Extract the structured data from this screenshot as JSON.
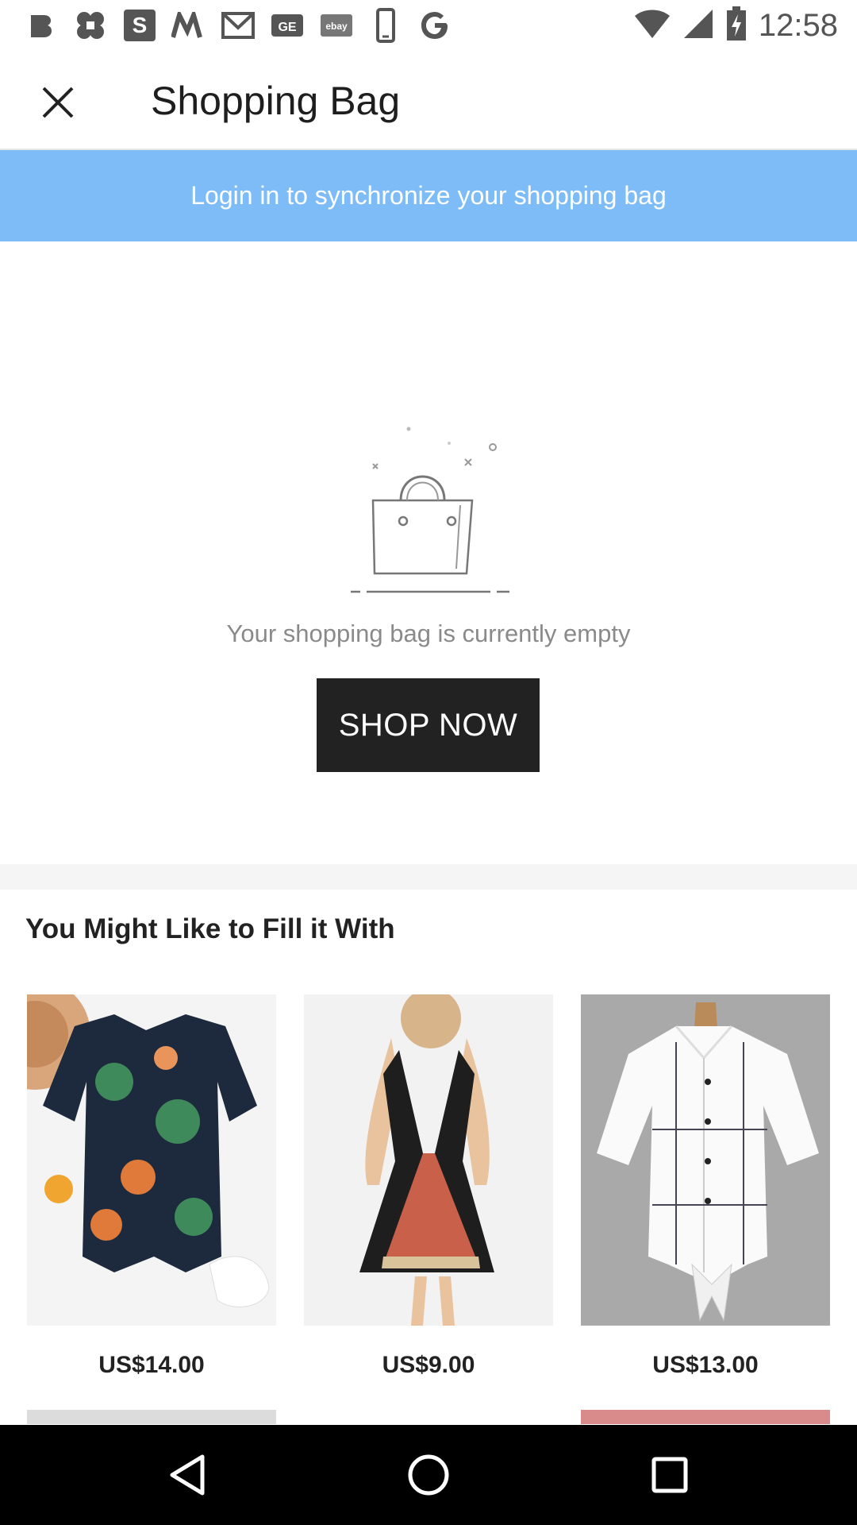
{
  "status_bar": {
    "time": "12:58",
    "left_icons": [
      "b-app-icon",
      "cluster-app-icon",
      "s-app-icon",
      "m-app-icon",
      "gmail-icon",
      "ge-app-icon",
      "ebay-icon",
      "phone-icon",
      "google-icon"
    ],
    "right_icons": [
      "wifi-icon",
      "signal-icon",
      "battery-icon"
    ]
  },
  "toolbar": {
    "title": "Shopping Bag",
    "close_icon": "close-icon"
  },
  "login_banner": {
    "text": "Login in to synchronize your shopping bag",
    "color": "#7ebcf7"
  },
  "empty_state": {
    "icon": "shopping-bag-icon",
    "message": "Your shopping bag is currently empty",
    "button_label": "SHOP NOW"
  },
  "recommendations": {
    "title": "You Might Like to Fill it With",
    "products": [
      {
        "image": "floral-romper-photo",
        "price": "US$14.00"
      },
      {
        "image": "halter-dress-photo",
        "price": "US$9.00"
      },
      {
        "image": "white-plaid-shirt-photo",
        "price": "US$13.00"
      }
    ]
  },
  "nav_bar": {
    "buttons": [
      "back-icon",
      "home-icon",
      "recents-icon"
    ]
  }
}
